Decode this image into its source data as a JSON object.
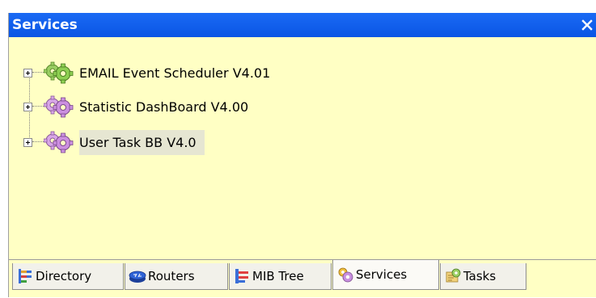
{
  "panel": {
    "title": "Services",
    "close_label": "×"
  },
  "tree": {
    "items": [
      {
        "label": "EMAIL Event Scheduler V4.01",
        "icon": "gear-green-icon",
        "selected": false
      },
      {
        "label": "Statistic DashBoard V4.00",
        "icon": "gear-purple-icon",
        "selected": false
      },
      {
        "label": "User Task  BB V4.0",
        "icon": "gear-purple-icon",
        "selected": true
      }
    ]
  },
  "tabs": [
    {
      "label": "Directory",
      "icon": "directory-icon",
      "active": false
    },
    {
      "label": "Routers",
      "icon": "router-icon",
      "active": false
    },
    {
      "label": "MIB Tree",
      "icon": "mib-tree-icon",
      "active": false
    },
    {
      "label": "Services",
      "icon": "gear-icon",
      "active": true
    },
    {
      "label": "Tasks",
      "icon": "tasks-icon",
      "active": false
    }
  ],
  "colors": {
    "title_bar": "#0a55e4",
    "panel_background": "#ffffc4",
    "selection_background": "#e6e6d2"
  }
}
